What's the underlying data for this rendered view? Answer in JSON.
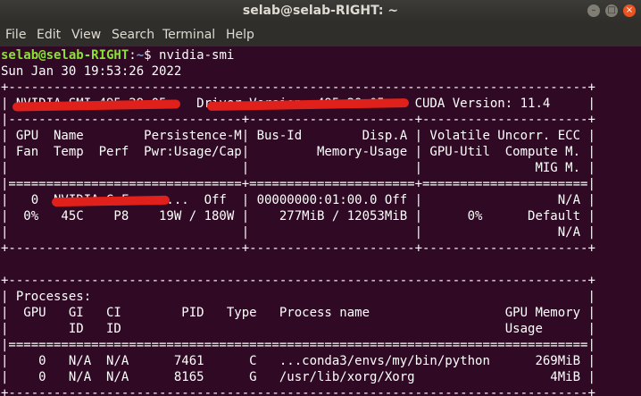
{
  "window": {
    "title": "selab@selab-RIGHT: ~",
    "min_glyph": "–",
    "max_glyph": "□",
    "close_glyph": "×"
  },
  "menu": [
    "File",
    "Edit",
    "View",
    "Search",
    "Terminal",
    "Help"
  ],
  "prompt": {
    "user_host": "selab@selab-RIGHT",
    "colon": ":",
    "path": "~",
    "symbol": "$ ",
    "command": "nvidia-smi"
  },
  "lines": [
    "Sun Jan 30 19:53:26 2022",
    "+-----------------------------------------------------------------------------+",
    "| NVIDIA-SMI 495.29.05    Driver Version: 495.29.05    CUDA Version: 11.4     |",
    "|-------------------------------+----------------------+----------------------+",
    "| GPU  Name        Persistence-M| Bus-Id        Disp.A | Volatile Uncorr. ECC |",
    "| Fan  Temp  Perf  Pwr:Usage/Cap|         Memory-Usage | GPU-Util  Compute M. |",
    "|                               |                      |               MIG M. |",
    "|===============================+======================+======================|",
    "|   0  NVIDIA GeForce ...  Off  | 00000000:01:00.0 Off |                  N/A |",
    "|  0%   45C    P8    19W / 180W |    277MiB / 12053MiB |      0%      Default |",
    "|                               |                      |                  N/A |",
    "+-------------------------------+----------------------+----------------------+",
    "",
    "+-----------------------------------------------------------------------------+",
    "| Processes:                                                                  |",
    "|  GPU   GI   CI        PID   Type   Process name                  GPU Memory |",
    "|        ID   ID                                                   Usage      |",
    "|=============================================================================|",
    "|    0   N/A  N/A      7461      C   ...conda3/envs/my/bin/python      269MiB |",
    "|    0   N/A  N/A      8165      G   /usr/lib/xorg/Xorg                  4MiB |",
    "+-----------------------------------------------------------------------------+"
  ]
}
